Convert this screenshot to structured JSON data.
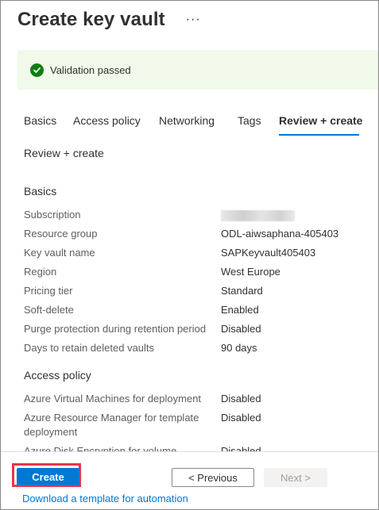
{
  "header": {
    "title": "Create key vault",
    "more_label": "···"
  },
  "validation": {
    "message": "Validation passed",
    "icon": "checkmark-circle-icon",
    "color": "#107c10"
  },
  "tabs": [
    {
      "label": "Basics",
      "active": false
    },
    {
      "label": "Access policy",
      "active": false
    },
    {
      "label": "Networking",
      "active": false
    },
    {
      "label": "Tags",
      "active": false
    },
    {
      "label": "Review + create",
      "active": true
    }
  ],
  "section_title": "Review + create",
  "basics": {
    "heading": "Basics",
    "rows": [
      {
        "label": "Subscription",
        "value": ""
      },
      {
        "label": "Resource group",
        "value": "ODL-aiwsaphana-405403"
      },
      {
        "label": "Key vault name",
        "value": "SAPKeyvault405403"
      },
      {
        "label": "Region",
        "value": "West Europe"
      },
      {
        "label": "Pricing tier",
        "value": "Standard"
      },
      {
        "label": "Soft-delete",
        "value": "Enabled"
      },
      {
        "label": "Purge protection during retention period",
        "value": "Disabled"
      },
      {
        "label": "Days to retain deleted vaults",
        "value": "90 days"
      }
    ]
  },
  "access_policy": {
    "heading": "Access policy",
    "rows": [
      {
        "label": "Azure Virtual Machines for deployment",
        "value": "Disabled"
      },
      {
        "label": "Azure Resource Manager for template deployment",
        "value": "Disabled"
      },
      {
        "label": "Azure Disk Encryption for volume",
        "value": "Disabled"
      }
    ]
  },
  "footer": {
    "create_label": "Create",
    "previous_label": "< Previous",
    "next_label": "Next >",
    "download_link": "Download a template for automation"
  },
  "colors": {
    "accent": "#0078d4",
    "highlight": "#e8364a",
    "validation_bg": "#f0f9ea"
  }
}
